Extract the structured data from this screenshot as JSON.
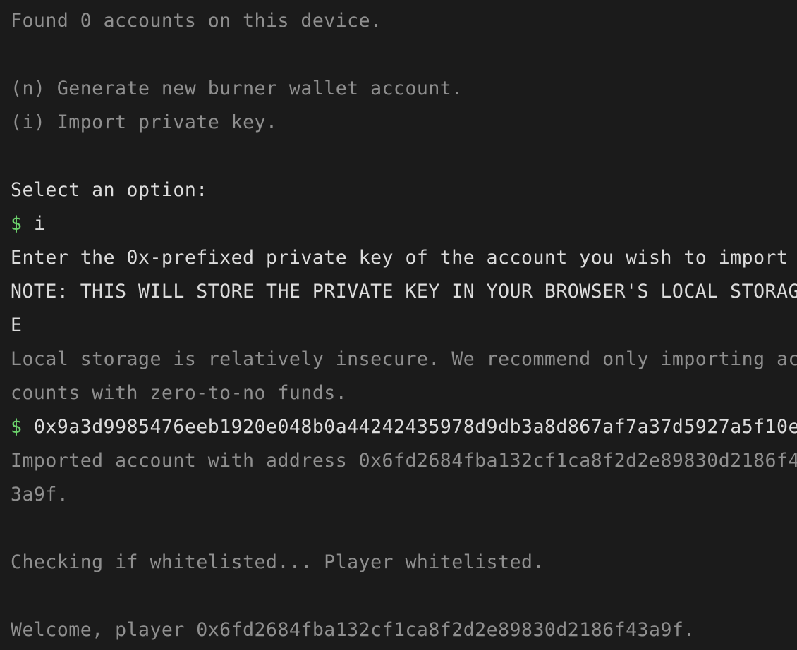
{
  "colors": {
    "background": "#1b1b1b",
    "dim_text": "#8f8f8f",
    "bright_text": "#dcdcdc",
    "prompt_symbol": "#6cd36c"
  },
  "terminal": {
    "found_accounts": "Found 0 accounts on this device.",
    "option_new": "(n) Generate new burner wallet account.",
    "option_import": "(i) Import private key.",
    "select_prompt": "Select an option:",
    "prompt_symbol": "$",
    "input_option": "i",
    "enter_key_prompt": "Enter the 0x-prefixed private key of the account you wish to import",
    "note_line_1": "NOTE: THIS WILL STORE THE PRIVATE KEY IN YOUR BROWSER'S LOCAL STORAG",
    "note_line_2": "E",
    "warning_line_1": "Local storage is relatively insecure. We recommend only importing ac",
    "warning_line_2": "counts with zero-to-no funds.",
    "input_private_key": "0x9a3d9985476eeb1920e048b0a44242435978d9db3a8d867af7a37d5927a5f10e",
    "imported_line_1": "Imported account with address 0x6fd2684fba132cf1ca8f2d2e89830d2186f4",
    "imported_line_2": "3a9f.",
    "whitelist_check": "Checking if whitelisted... Player whitelisted.",
    "welcome": "Welcome, player 0x6fd2684fba132cf1ca8f2d2e89830d2186f43a9f."
  }
}
